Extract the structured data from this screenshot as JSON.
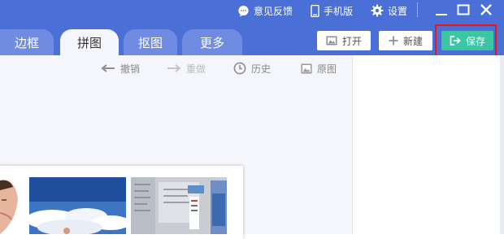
{
  "topbar": {
    "feedback_label": "意见反馈",
    "mobile_label": "手机版",
    "settings_label": "设置"
  },
  "tabs": [
    {
      "label": "边框",
      "active": false
    },
    {
      "label": "拼图",
      "active": true
    },
    {
      "label": "抠图",
      "active": false
    },
    {
      "label": "更多",
      "active": false
    }
  ],
  "actions": {
    "open_label": "打开",
    "new_label": "新建",
    "save_label": "保存"
  },
  "toolbar": {
    "undo_label": "撤销",
    "redo_label": "重做",
    "history_label": "历史",
    "original_label": "原图"
  },
  "colors": {
    "header": "#4a6fd6",
    "tab": "#6f8ce2",
    "save": "#3cc6a4",
    "highlight": "#e8171c"
  }
}
